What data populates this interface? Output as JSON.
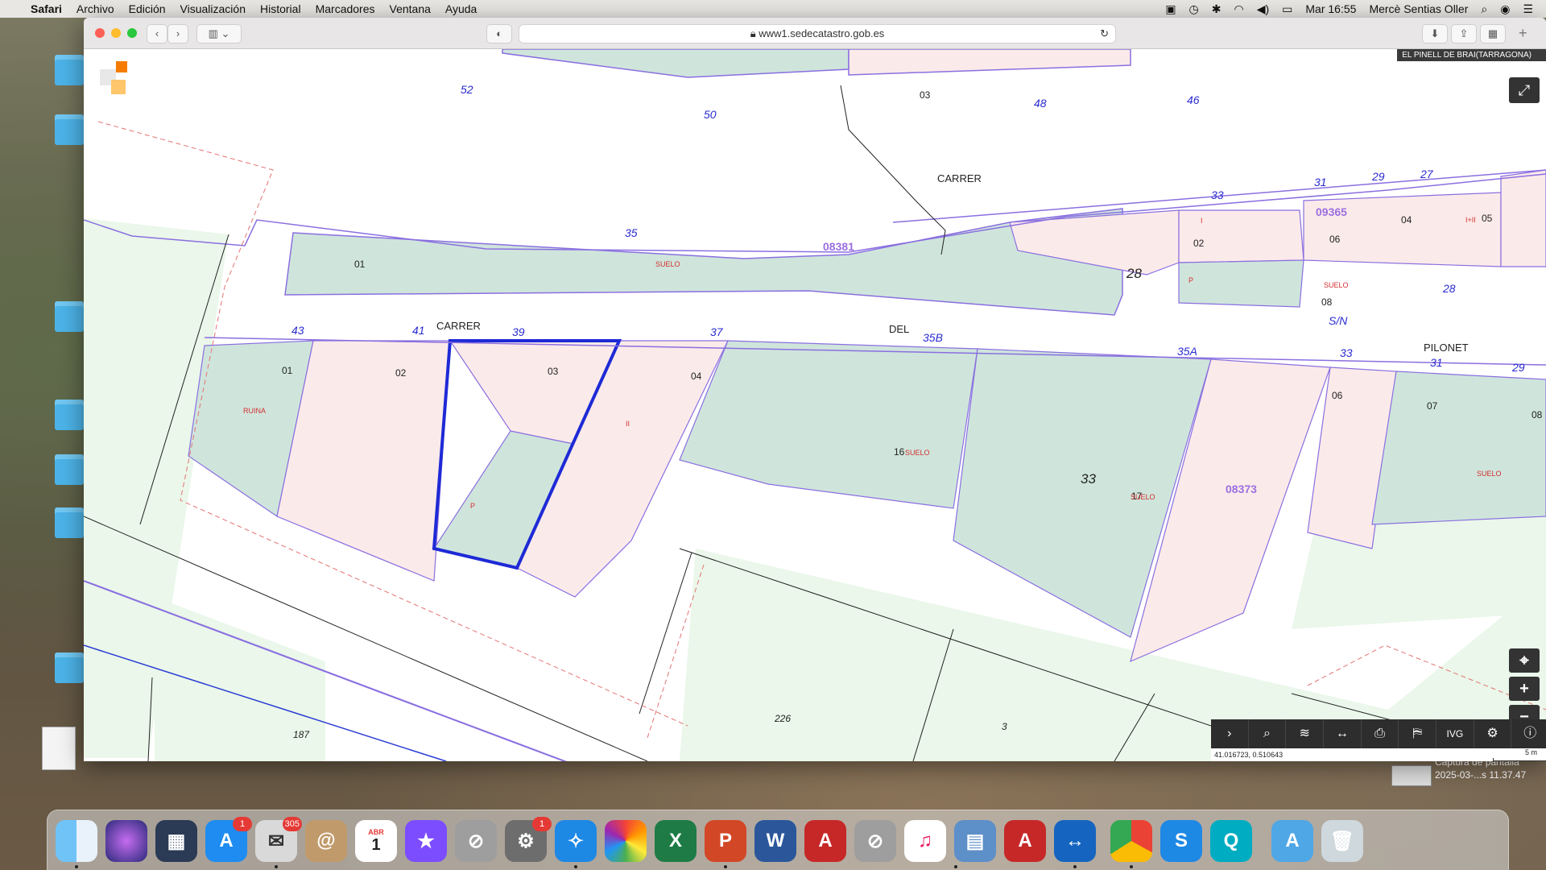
{
  "menubar": {
    "apple": "",
    "app": "Safari",
    "menus": [
      "Archivo",
      "Edición",
      "Visualización",
      "Historial",
      "Marcadores",
      "Ventana",
      "Ayuda"
    ],
    "clock": "Mar 16:55",
    "user": "Mercè Sentias Oller"
  },
  "browser": {
    "url": "www1.sedecatastro.gob.es"
  },
  "map": {
    "place": "EL PINELL DE BRAI(TARRAGONA)",
    "coords": "41.016723, 0.510643",
    "scale": "5 m",
    "street_labels": [
      "CARRER",
      "CARRER",
      "DEL",
      "PILONET"
    ],
    "street_numbers": [
      "52",
      "50",
      "48",
      "46",
      "35",
      "33",
      "31",
      "29",
      "27",
      "43",
      "41",
      "39",
      "37",
      "35B",
      "35A",
      "33",
      "31",
      "29",
      "28",
      "S/N"
    ],
    "parcel_labels": [
      "03",
      "01",
      "02",
      "06",
      "04",
      "05",
      "08",
      "01",
      "02",
      "03",
      "04",
      "16",
      "17",
      "06",
      "07",
      "08"
    ],
    "block_labels": [
      "28",
      "33",
      "226",
      "187",
      "3"
    ],
    "ref_labels": [
      "09365",
      "08381",
      "08373"
    ],
    "use_labels": [
      "SUELO",
      "SUELO",
      "SUELO",
      "SUELO",
      "SUELO",
      "RUINA",
      "P",
      "P",
      "I",
      "II",
      "I+II"
    ]
  },
  "desktop": {
    "capture_label": "Captura de pantalla\n2025-03-...s 11.37.47"
  },
  "dock": {
    "mail_badge": "305",
    "appstore_badge": "1",
    "prefs_badge": "1",
    "calendar_month": "ABR",
    "calendar_day": "1"
  }
}
